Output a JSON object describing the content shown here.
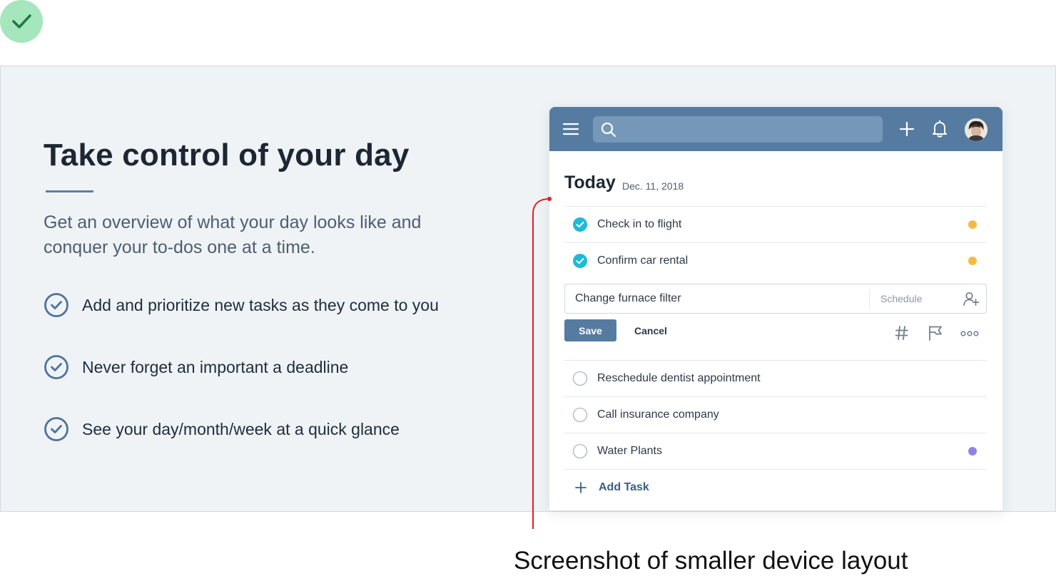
{
  "page": {
    "title": "Take control of your day",
    "subtitle": "Get an overview of what your day looks like and conquer your to-dos one at a time.",
    "benefits": [
      "Add and prioritize new tasks as they come to you",
      "Never forget an important a deadline",
      "See your day/month/week at a quick glance"
    ],
    "caption": "Screenshot of smaller device layout"
  },
  "app": {
    "search_placeholder": "",
    "today_label": "Today",
    "date": "Dec. 11, 2018",
    "completed_tasks": [
      {
        "label": "Check in to flight",
        "dot_color": "#f5b945"
      },
      {
        "label": "Confirm car rental",
        "dot_color": "#f5b945"
      }
    ],
    "edit": {
      "value": "Change furnace filter",
      "schedule_label": "Schedule",
      "save_label": "Save",
      "cancel_label": "Cancel"
    },
    "open_tasks": [
      {
        "label": "Reschedule dentist appointment",
        "dot_color": ""
      },
      {
        "label": "Call insurance company",
        "dot_color": ""
      },
      {
        "label": "Water Plants",
        "dot_color": "#8d85e6"
      }
    ],
    "add_task_label": "Add Task"
  },
  "colors": {
    "accent": "#557ba1",
    "check": "#1fbad6",
    "badge": "#a6e6bd",
    "callout": "#e02020"
  },
  "icons": [
    "check-icon",
    "menu-icon",
    "search-icon",
    "plus-icon",
    "bell-icon",
    "avatar",
    "add-person-icon",
    "hash-icon",
    "flag-icon",
    "more-icon"
  ]
}
